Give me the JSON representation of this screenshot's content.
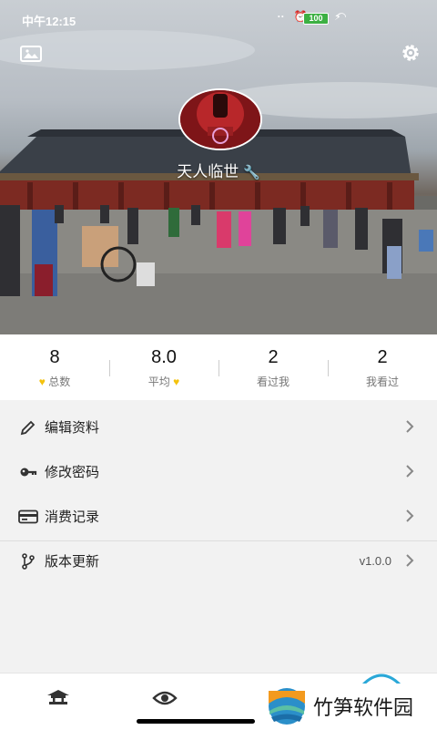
{
  "status": {
    "time": "中午12:15",
    "battery": "100"
  },
  "profile": {
    "name": "天人临世"
  },
  "stats": [
    {
      "value": "8",
      "label": "总数",
      "heart": "before"
    },
    {
      "value": "8.0",
      "label": "平均",
      "heart": "after"
    },
    {
      "value": "2",
      "label": "看过我",
      "heart": ""
    },
    {
      "value": "2",
      "label": "我看过",
      "heart": ""
    }
  ],
  "menu": [
    {
      "label": "编辑资料",
      "icon": "pencil-icon",
      "value": ""
    },
    {
      "label": "修改密码",
      "icon": "key-icon",
      "value": ""
    },
    {
      "label": "消费记录",
      "icon": "card-icon",
      "value": ""
    },
    {
      "label": "版本更新",
      "icon": "branch-icon",
      "value": "v1.0.0"
    }
  ],
  "watermark": {
    "text": "竹笋软件园"
  },
  "colors": {
    "heart": "#f4c20d",
    "background": "#f2f2f2"
  }
}
